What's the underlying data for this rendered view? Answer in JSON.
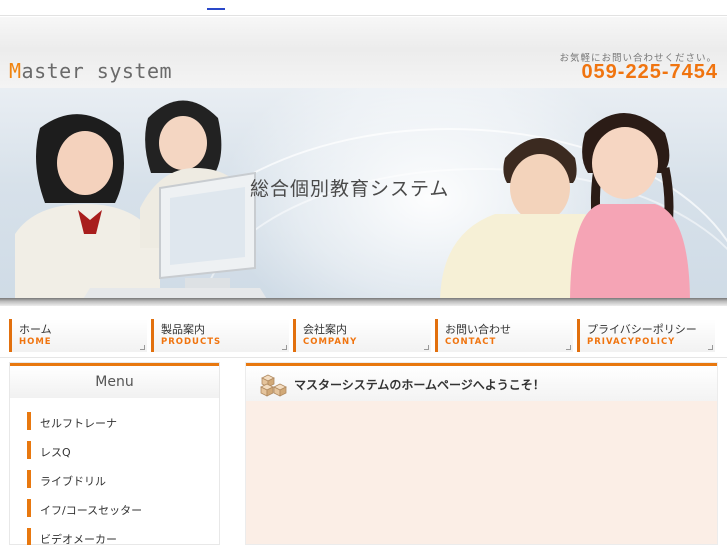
{
  "header": {
    "logo_first": "M",
    "logo_rest": "aster system",
    "contact_caption": "お気軽にお問い合わせください。",
    "phone": "059-225-7454"
  },
  "hero": {
    "caption": "総合個別教育システム"
  },
  "nav": [
    {
      "jp": "ホーム",
      "en": "HOME"
    },
    {
      "jp": "製品案内",
      "en": "PRODUCTS"
    },
    {
      "jp": "会社案内",
      "en": "COMPANY"
    },
    {
      "jp": "お問い合わせ",
      "en": "CONTACT"
    },
    {
      "jp": "プライバシーポリシー",
      "en": "PRIVACYPOLICY"
    }
  ],
  "sidebar": {
    "title": "Menu",
    "items": [
      {
        "label": "セルフトレーナ"
      },
      {
        "label": "レスQ"
      },
      {
        "label": "ライブドリル"
      },
      {
        "label": "イフ/コースセッター"
      },
      {
        "label": "ビデオメーカー"
      }
    ]
  },
  "main": {
    "title": "マスターシステムのホームページへようこそ！"
  },
  "colors": {
    "accent": "#e8780f",
    "phone": "#f0740f"
  }
}
